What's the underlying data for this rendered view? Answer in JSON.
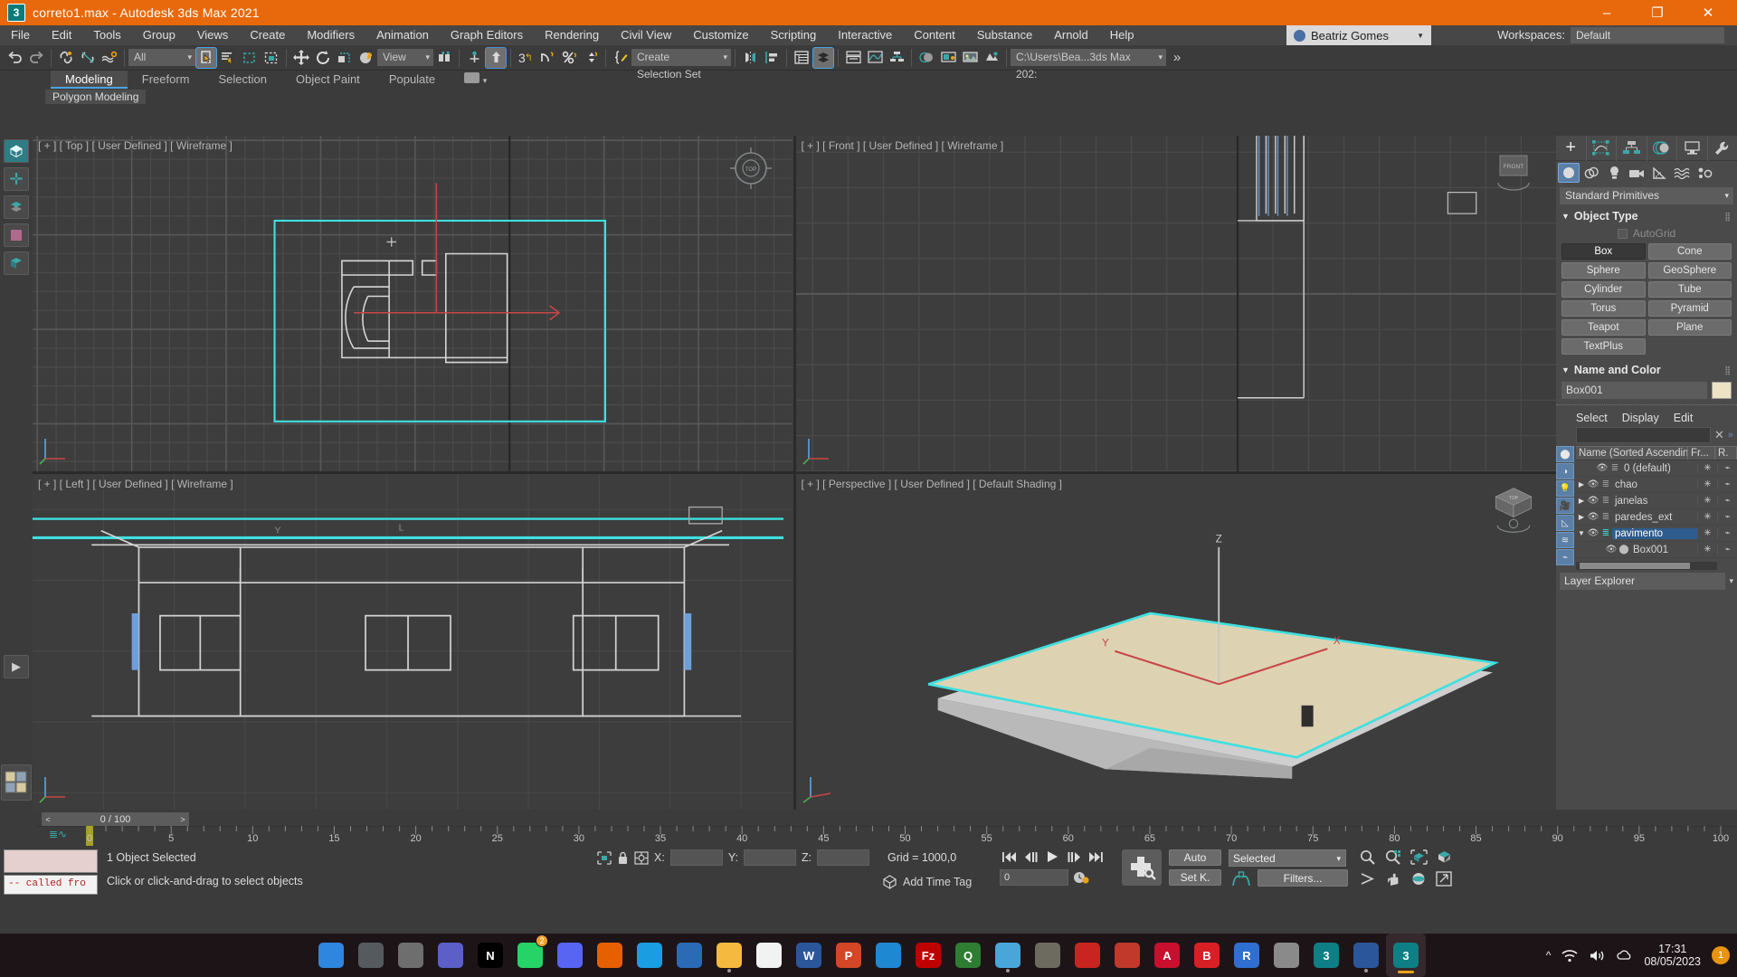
{
  "titlebar": {
    "app_icon": "3dsmax-icon",
    "title": "correto1.max - Autodesk 3ds Max 2021",
    "minimize": "–",
    "maximize": "❐",
    "close": "✕"
  },
  "menubar": {
    "items": [
      {
        "label": "File"
      },
      {
        "label": "Edit"
      },
      {
        "label": "Tools"
      },
      {
        "label": "Group"
      },
      {
        "label": "Views"
      },
      {
        "label": "Create"
      },
      {
        "label": "Modifiers"
      },
      {
        "label": "Animation"
      },
      {
        "label": "Graph Editors"
      },
      {
        "label": "Rendering"
      },
      {
        "label": "Civil View"
      },
      {
        "label": "Customize"
      },
      {
        "label": "Scripting"
      },
      {
        "label": "Interactive"
      },
      {
        "label": "Content"
      },
      {
        "label": "Substance"
      },
      {
        "label": "Arnold"
      },
      {
        "label": "Help"
      }
    ],
    "account_name": "Beatriz Gomes",
    "workspaces_label": "Workspaces:",
    "workspace_value": "Default"
  },
  "toolbar": {
    "undo": "undo-arrow",
    "redo": "redo-arrow",
    "selection_filter": "All",
    "reference_coord_system": "View",
    "named_selection_set": "Create Selection Set",
    "project_path": "C:\\Users\\Bea...3ds Max 202:",
    "overflow": "»"
  },
  "ribbon": {
    "tabs": [
      {
        "label": "Modeling",
        "active": true
      },
      {
        "label": "Freeform",
        "active": false
      },
      {
        "label": "Selection",
        "active": false
      },
      {
        "label": "Object Paint",
        "active": false
      },
      {
        "label": "Populate",
        "active": false
      }
    ],
    "panel_label": "Polygon Modeling"
  },
  "viewports": [
    {
      "label": "[ + ] [ Top ] [ User Defined ] [ Wireframe ]",
      "active": false,
      "name": "viewport-top"
    },
    {
      "label": "[ + ] [ Front ] [ User Defined ] [ Wireframe ]",
      "active": false,
      "name": "viewport-front"
    },
    {
      "label": "[ + ] [ Left ] [ User Defined ] [ Wireframe ]",
      "active": false,
      "name": "viewport-left"
    },
    {
      "label": "[ + ] [ Perspective ] [ User Defined ] [ Default Shading ]",
      "active": true,
      "name": "viewport-perspective"
    }
  ],
  "command_panel": {
    "tabs": [
      "create",
      "modify",
      "hierarchy",
      "motion",
      "display",
      "utilities"
    ],
    "create_subtabs": [
      "geometry",
      "shapes",
      "lights",
      "cameras",
      "helpers",
      "space-warps",
      "systems"
    ],
    "category": "Standard Primitives",
    "object_type": {
      "title": "Object Type",
      "autogrid": "AutoGrid",
      "buttons": [
        {
          "label": "Box",
          "pressed": true
        },
        {
          "label": "Cone",
          "pressed": false
        },
        {
          "label": "Sphere",
          "pressed": false
        },
        {
          "label": "GeoSphere",
          "pressed": false
        },
        {
          "label": "Cylinder",
          "pressed": false
        },
        {
          "label": "Tube",
          "pressed": false
        },
        {
          "label": "Torus",
          "pressed": false
        },
        {
          "label": "Pyramid",
          "pressed": false
        },
        {
          "label": "Teapot",
          "pressed": false
        },
        {
          "label": "Plane",
          "pressed": false
        },
        {
          "label": "TextPlus",
          "pressed": false
        }
      ]
    },
    "name_and_color": {
      "title": "Name and Color",
      "object_name": "Box001",
      "color": "#ede3c4"
    }
  },
  "scene_explorer": {
    "menus": [
      "Select",
      "Display",
      "Edit"
    ],
    "search_value": "",
    "clear_icon": "close-icon",
    "columns": [
      "Name (Sorted Ascending)",
      "Fr...",
      "R."
    ],
    "sort_indicator": "▲",
    "rows": [
      {
        "name": "0 (default)",
        "indent": 1,
        "expandable": false,
        "expanded": false,
        "selected": false,
        "type": "layer"
      },
      {
        "name": "chao",
        "indent": 0,
        "expandable": true,
        "expanded": false,
        "selected": false,
        "type": "layer"
      },
      {
        "name": "janelas",
        "indent": 0,
        "expandable": true,
        "expanded": false,
        "selected": false,
        "type": "layer"
      },
      {
        "name": "paredes_ext",
        "indent": 0,
        "expandable": true,
        "expanded": false,
        "selected": false,
        "type": "layer"
      },
      {
        "name": "pavimento",
        "indent": 0,
        "expandable": true,
        "expanded": true,
        "selected": true,
        "type": "layer-active"
      },
      {
        "name": "Box001",
        "indent": 2,
        "expandable": false,
        "expanded": false,
        "selected": false,
        "type": "object"
      }
    ],
    "footer_label": "Layer Explorer"
  },
  "timeline": {
    "frame_display": "0 / 100",
    "prev_key": "<",
    "next_key": ">",
    "ticks": [
      "0",
      "5",
      "10",
      "15",
      "20",
      "25",
      "30",
      "35",
      "40",
      "45",
      "50",
      "55",
      "60",
      "65",
      "70",
      "75",
      "80",
      "85",
      "90",
      "95",
      "100"
    ],
    "current_frame": 0
  },
  "statusbar": {
    "maxscript_entry": "--  called fro",
    "selection_status": "1 Object Selected",
    "prompt": "Click or click-and-drag to select objects",
    "x_label": "X:",
    "x_value": "",
    "y_label": "Y:",
    "y_value": "",
    "z_label": "Z:",
    "z_value": "",
    "grid": "Grid = 1000,0",
    "add_time_tag": "Add Time Tag",
    "key_frame_value": "0",
    "auto_key": "Auto",
    "set_key": "Set K.",
    "key_filter_mode": "Selected",
    "filters": "Filters...",
    "nav_icons": [
      "zoom-icon",
      "zoom-all-icon",
      "zoom-extents-icon",
      "zoom-extents-selected-icon",
      "field-of-view-icon",
      "pan-icon",
      "orbit-icon",
      "maximize-viewport-icon"
    ]
  },
  "taskbar": {
    "apps": [
      {
        "name": "start-icon",
        "glyph": "",
        "color": "#2e86de"
      },
      {
        "name": "search-icon",
        "glyph": "",
        "color": "#555a5e"
      },
      {
        "name": "task-view-icon",
        "glyph": "",
        "color": "#6e6e6e"
      },
      {
        "name": "teams-icon",
        "glyph": "",
        "color": "#5b5fc7"
      },
      {
        "name": "netflix-icon",
        "glyph": "N",
        "color": "#000000"
      },
      {
        "name": "whatsapp-icon",
        "glyph": "",
        "color": "#25d366",
        "badge": "2"
      },
      {
        "name": "discord-icon",
        "glyph": "",
        "color": "#5865f2"
      },
      {
        "name": "firefox-icon",
        "glyph": "",
        "color": "#e66000"
      },
      {
        "name": "edge-icon",
        "glyph": "",
        "color": "#1b9de2"
      },
      {
        "name": "thunderbird-icon",
        "glyph": "",
        "color": "#2b6bb5"
      },
      {
        "name": "file-explorer-icon",
        "glyph": "",
        "color": "#f5b93f",
        "dot": true
      },
      {
        "name": "notepad-icon",
        "glyph": "",
        "color": "#f2f2f2"
      },
      {
        "name": "word-icon",
        "glyph": "W",
        "color": "#2b579a"
      },
      {
        "name": "powerpoint-icon",
        "glyph": "P",
        "color": "#d24726"
      },
      {
        "name": "vscode-icon",
        "glyph": "",
        "color": "#1e88d3"
      },
      {
        "name": "filezilla-icon",
        "glyph": "Fz",
        "color": "#bf0000"
      },
      {
        "name": "qbittorrent-icon",
        "glyph": "Q",
        "color": "#2e7d32"
      },
      {
        "name": "paint-icon",
        "glyph": "",
        "color": "#49a6d9",
        "dot": true
      },
      {
        "name": "gimp-icon",
        "glyph": "",
        "color": "#6d6a60"
      },
      {
        "name": "pdf-icon",
        "glyph": "",
        "color": "#c9241f"
      },
      {
        "name": "sketchup-icon",
        "glyph": "",
        "color": "#c0392b"
      },
      {
        "name": "autocad-icon",
        "glyph": "A",
        "color": "#c8102e"
      },
      {
        "name": "revit-b-icon",
        "glyph": "B",
        "color": "#d91f26"
      },
      {
        "name": "revit-icon",
        "glyph": "R",
        "color": "#2f6fd0"
      },
      {
        "name": "photoshop-lightroom-icon",
        "glyph": "",
        "color": "#8a8a8a",
        "dot": false
      },
      {
        "name": "3dsmax-icon-1",
        "glyph": "3",
        "color": "#0e7f84"
      },
      {
        "name": "word-doc-icon",
        "glyph": "",
        "color": "#2b579a",
        "dot": true
      },
      {
        "name": "3dsmax-icon-active",
        "glyph": "3",
        "color": "#0e7f84",
        "active": true
      }
    ],
    "tray": {
      "chevron": "^",
      "wifi_icon": "wifi-icon",
      "volume_icon": "volume-icon",
      "onedrive_icon": "onedrive-icon",
      "time": "17:31",
      "date": "08/05/2023",
      "notification_count": "1"
    }
  }
}
